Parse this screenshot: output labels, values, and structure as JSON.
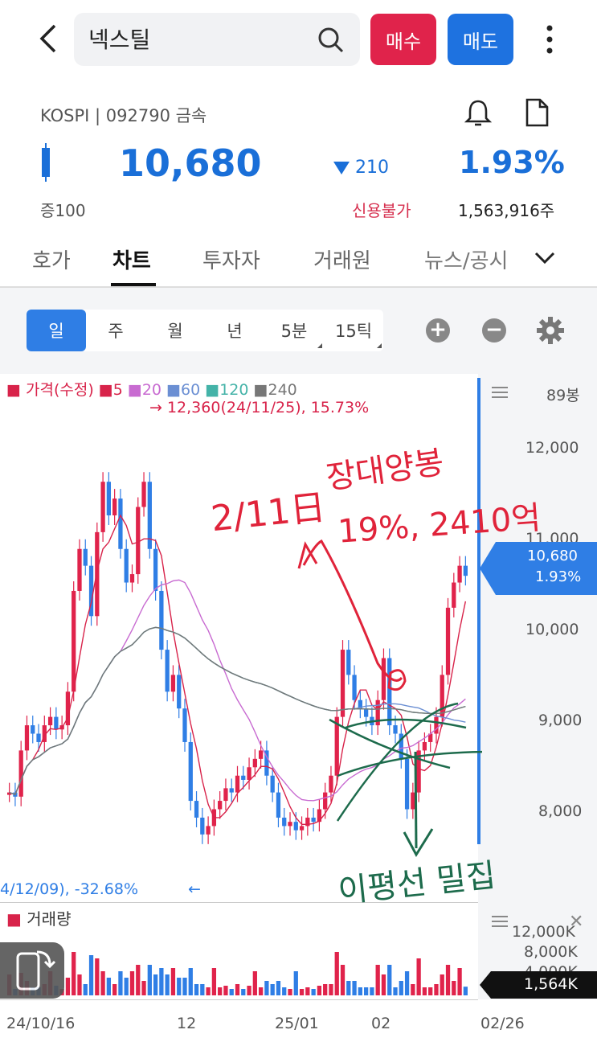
{
  "header": {
    "search_value": "넥스틸",
    "buy_label": "매수",
    "sell_label": "매도"
  },
  "stock": {
    "market_line": "KOSPI | 092790 금속",
    "price": "10,680",
    "change": "210",
    "change_pct": "1.93%",
    "margin": "증100",
    "credit": "신용불가",
    "volume": "1,563,916주"
  },
  "tabs": [
    {
      "label": "호가"
    },
    {
      "label": "차트"
    },
    {
      "label": "투자자"
    },
    {
      "label": "거래원"
    },
    {
      "label": "뉴스/공시"
    }
  ],
  "periods": [
    {
      "label": "일"
    },
    {
      "label": "주"
    },
    {
      "label": "월"
    },
    {
      "label": "년"
    },
    {
      "label": "5분"
    },
    {
      "label": "15틱"
    }
  ],
  "legend": {
    "price_label": "가격(수정)",
    "ma": [
      "5",
      "20",
      "60",
      "120",
      "240"
    ],
    "colors": {
      "ma5": "#d8234a",
      "ma20": "#c86bd1",
      "ma60": "#6b8fd3",
      "ma120": "#44b3a8",
      "ma240": "#777777",
      "up": "#e0234b",
      "down": "#2f7ee5"
    }
  },
  "chart_data": {
    "type": "candlestick",
    "title": "",
    "bars_count": "89봉",
    "y_ticks": [
      "12,000",
      "11,000",
      "10,000",
      "9,000",
      "8,000"
    ],
    "x_ticks": [
      "24/10/16",
      "12",
      "25/01",
      "02",
      "02/26"
    ],
    "high_annotation": "12,360(24/11/25), 15.73%",
    "low_annotation": "4/12/09), -32.68%",
    "current_price_label": "10,680",
    "current_pct_label": "1.93%",
    "volume_label": "거래량",
    "volume_ticks": [
      "12,000K",
      "8,000K",
      "4,000K"
    ],
    "volume_current": "1,564K",
    "ylim": [
      7450,
      12750
    ]
  },
  "handwritten": {
    "line1": "2/11日",
    "line2": "장대양봉",
    "line3": "19%, 2410억",
    "line4": "이평선 밀집"
  }
}
